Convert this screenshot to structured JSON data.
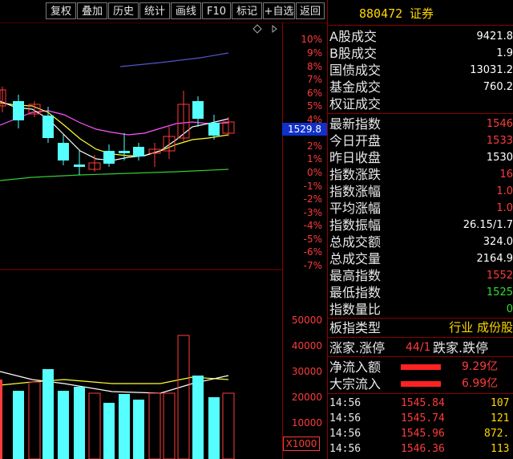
{
  "toolbar": {
    "buttons": [
      "复权",
      "叠加",
      "历史",
      "统计",
      "画线",
      "F10",
      "标记",
      "+自选",
      "返回"
    ]
  },
  "chart": {
    "price_marker": "1529.8",
    "pct_ticks": [
      "10%",
      "9%",
      "8%",
      "7%",
      "6%",
      "5%",
      "4%",
      "3%",
      "2%",
      "1%",
      "0%",
      "-1%",
      "-2%",
      "-3%",
      "-4%",
      "-5%",
      "-6%",
      "-7%"
    ],
    "vol_ticks": [
      "50000",
      "40000",
      "30000",
      "20000",
      "10000"
    ],
    "vol_unit": "X1000",
    "colors": {
      "up": "#ff3b3b",
      "down": "#55ffff",
      "ma5": "#ffffff",
      "ma10": "#ffff33",
      "ma20": "#ff55ff",
      "ma60": "#33cc33",
      "ma120": "#5555cc"
    }
  },
  "header": {
    "code": "880472",
    "name": "证券"
  },
  "stats": [
    {
      "label": "A股成交",
      "value": "9421.8"
    },
    {
      "label": "B股成交",
      "value": "1.9"
    },
    {
      "label": "国债成交",
      "value": "13031.2"
    },
    {
      "label": "基金成交",
      "value": "760.2"
    },
    {
      "label": "权证成交",
      "value": ""
    },
    {
      "label": "最新指数",
      "value": "1546"
    },
    {
      "label": "今日开盘",
      "value": "1533"
    },
    {
      "label": "昨日收盘",
      "value": "1530"
    },
    {
      "label": "指数涨跌",
      "value": "16"
    },
    {
      "label": "指数涨幅",
      "value": "1.0"
    },
    {
      "label": "平均涨幅",
      "value": "1.0"
    },
    {
      "label": "指数振幅",
      "value": "26.15/1.7"
    },
    {
      "label": "总成交额",
      "value": "324.0"
    },
    {
      "label": "总成交量",
      "value": "2164.9"
    },
    {
      "label": "最高指数",
      "value": "1552"
    },
    {
      "label": "最低指数",
      "value": "1525"
    },
    {
      "label": "指数量比",
      "value": "0"
    },
    {
      "label": "板指类型",
      "value": "行业 成份股"
    }
  ],
  "updown": {
    "up_label": "涨家.涨停",
    "up_value": "44/1",
    "down_label": "跌家.跌停"
  },
  "flows": [
    {
      "label": "净流入额",
      "value": "9.29亿",
      "level": 0.9
    },
    {
      "label": "大宗流入",
      "value": "6.99亿",
      "level": 0.9
    }
  ],
  "trades": [
    {
      "time": "14:56",
      "price": "1545.84",
      "vol": "107"
    },
    {
      "time": "14:56",
      "price": "1545.74",
      "vol": "121"
    },
    {
      "time": "14:56",
      "price": "1545.96",
      "vol": "872."
    },
    {
      "time": "14:56",
      "price": "1546.36",
      "vol": "113"
    }
  ]
}
